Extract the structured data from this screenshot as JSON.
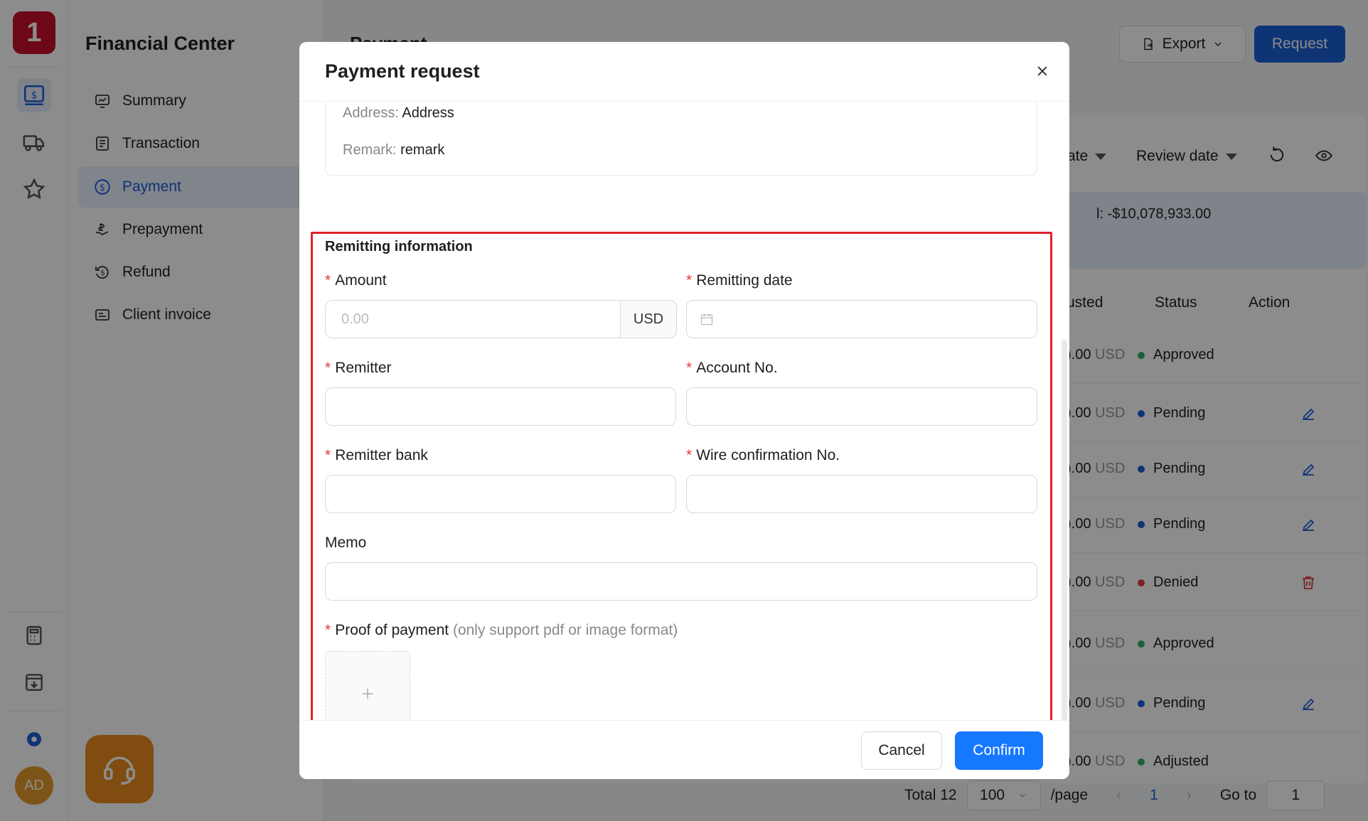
{
  "app": {
    "logo_text": "1",
    "avatar_text": "AD",
    "section_title": "Financial Center"
  },
  "nav": {
    "items": [
      {
        "label": "Summary",
        "icon": "chart-monitor-icon"
      },
      {
        "label": "Transaction",
        "icon": "ledger-icon"
      },
      {
        "label": "Payment",
        "icon": "dollar-circle-icon",
        "active": true
      },
      {
        "label": "Prepayment",
        "icon": "hand-dollar-icon"
      },
      {
        "label": "Refund",
        "icon": "refund-icon"
      },
      {
        "label": "Client invoice",
        "icon": "invoice-icon"
      }
    ]
  },
  "page": {
    "title": "Payment",
    "export_label": "Export",
    "request_label": "Request",
    "filters": {
      "date_partial": "ate",
      "review_date": "Review date"
    },
    "summary_amount": "l: -$10,078,933.00",
    "columns": {
      "adjusted_partial": "usted",
      "status": "Status",
      "action": "Action"
    },
    "rows": [
      {
        "amount": ").00",
        "currency": "USD",
        "status": "Approved",
        "status_color": "#2fb36b",
        "action": ""
      },
      {
        "amount": ").00",
        "currency": "USD",
        "status": "Pending",
        "status_color": "#1d5fd6",
        "action": "edit"
      },
      {
        "amount": ").00",
        "currency": "USD",
        "status": "Pending",
        "status_color": "#1d5fd6",
        "action": "edit"
      },
      {
        "amount": ").00",
        "currency": "USD",
        "status": "Pending",
        "status_color": "#1d5fd6",
        "action": "edit"
      },
      {
        "amount": ").00",
        "currency": "USD",
        "status": "Denied",
        "status_color": "#e23b3b",
        "action": "delete"
      },
      {
        "amount": ").00",
        "currency": "USD",
        "status": "Approved",
        "status_color": "#2fb36b",
        "action": ""
      },
      {
        "amount": ").00",
        "currency": "USD",
        "status": "Pending",
        "status_color": "#1d5fd6",
        "action": "edit"
      },
      {
        "amount": ").00",
        "currency": "USD",
        "status": "Adjusted",
        "status_color": "#2fb36b",
        "action": ""
      }
    ],
    "pager": {
      "total": "Total 12",
      "page_size": "100",
      "per_page": "/page",
      "current": "1",
      "goto_label": "Go to",
      "goto_value": "1"
    }
  },
  "modal": {
    "title": "Payment request",
    "info": {
      "address_label": "Address:",
      "address_value": "Address",
      "remark_label": "Remark:",
      "remark_value": "remark"
    },
    "section_title": "Remitting information",
    "fields": {
      "amount": {
        "label": "Amount",
        "placeholder": "0.00",
        "addon": "USD"
      },
      "remitting_date": {
        "label": "Remitting date"
      },
      "remitter": {
        "label": "Remitter"
      },
      "account_no": {
        "label": "Account No."
      },
      "remitter_bank": {
        "label": "Remitter bank"
      },
      "wire_no": {
        "label": "Wire confirmation No."
      },
      "memo": {
        "label": "Memo"
      },
      "proof": {
        "label": "Proof of payment",
        "hint": "(only support pdf or image format)"
      }
    },
    "cancel_label": "Cancel",
    "confirm_label": "Confirm"
  },
  "colors": {
    "primary": "#1677ff",
    "highlight": "#e0202a",
    "brand": "#c8102e"
  }
}
